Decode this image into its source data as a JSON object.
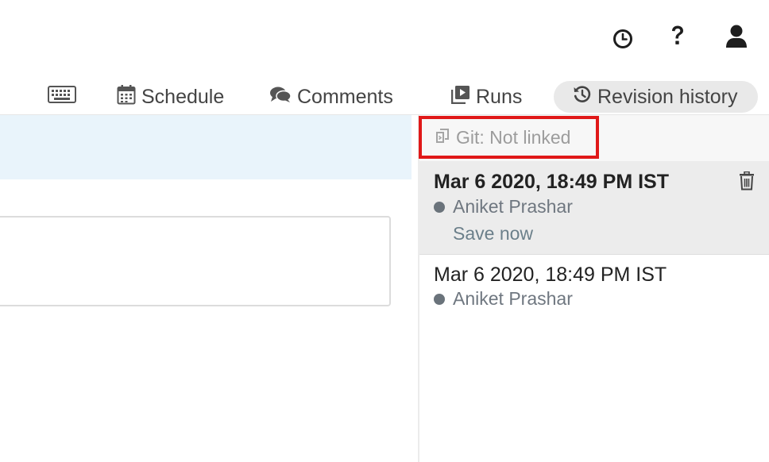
{
  "header": {
    "icons": [
      "clock-icon",
      "help-icon",
      "user-icon"
    ]
  },
  "tabs": [
    {
      "label": "",
      "icon": "keyboard-icon"
    },
    {
      "label": "Schedule",
      "icon": "calendar-icon"
    },
    {
      "label": "Comments",
      "icon": "comments-icon"
    },
    {
      "label": "Runs",
      "icon": "runs-icon"
    },
    {
      "label": "Revision history",
      "icon": "history-icon",
      "active": true
    }
  ],
  "git": {
    "label": "Git: Not linked",
    "icon": "git-icon",
    "highlight_color": "#e01818"
  },
  "revisions": [
    {
      "date": "Mar 6 2020, 18:49 PM IST",
      "author": "Aniket Prashar",
      "action": "Save now",
      "selected": true,
      "icon": "trash-icon"
    },
    {
      "date": "Mar 6 2020, 18:49 PM IST",
      "author": "Aniket Prashar",
      "selected": false
    }
  ],
  "colors": {
    "band": "#e9f4fb",
    "selected_bg": "#ececec",
    "active_tab_bg": "#e9e9e9"
  }
}
